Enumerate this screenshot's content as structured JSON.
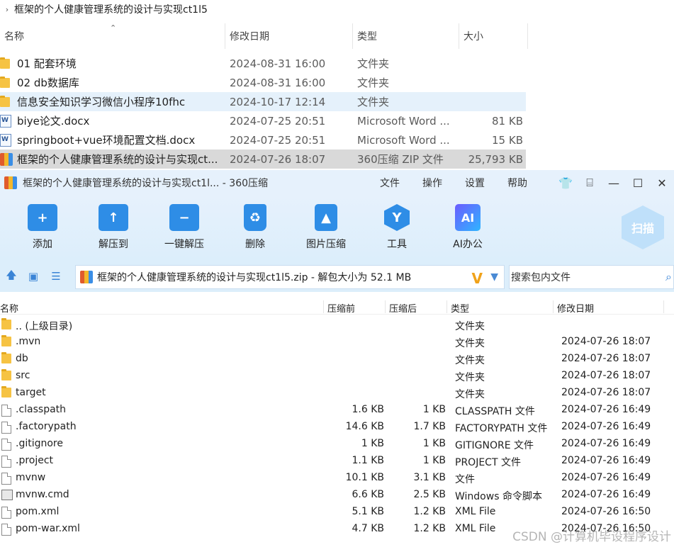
{
  "explorer": {
    "breadcrumb": "框架的个人健康管理系统的设计与实现ct1l5",
    "columns": {
      "name": "名称",
      "modified": "修改日期",
      "type": "类型",
      "size": "大小"
    },
    "rows": [
      {
        "name": "01 配套环境",
        "date": "2024-08-31 16:00",
        "type": "文件夹",
        "size": "",
        "icon": "folder-icon"
      },
      {
        "name": "02 db数据库",
        "date": "2024-08-31 16:00",
        "type": "文件夹",
        "size": "",
        "icon": "folder-icon"
      },
      {
        "name": "信息安全知识学习微信小程序10fhc",
        "date": "2024-10-17 12:14",
        "type": "文件夹",
        "size": "",
        "icon": "folder-icon"
      },
      {
        "name": "biye论文.docx",
        "date": "2024-07-25 20:51",
        "type": "Microsoft Word ...",
        "size": "81 KB",
        "icon": "word-doc-icon"
      },
      {
        "name": "springboot+vue环境配置文档.docx",
        "date": "2024-07-25 20:51",
        "type": "Microsoft Word ...",
        "size": "15 KB",
        "icon": "word-doc-icon"
      },
      {
        "name": "框架的个人健康管理系统的设计与实现ct...",
        "date": "2024-07-26 18:07",
        "type": "360压缩 ZIP 文件",
        "size": "25,793 KB",
        "icon": "zip-icon"
      }
    ]
  },
  "window": {
    "title": "框架的个人健康管理系统的设计与实现ct1l... - 360压缩",
    "menu": [
      "文件",
      "操作",
      "设置",
      "帮助"
    ],
    "toolbar": [
      {
        "label": "添加",
        "icon": "add-icon"
      },
      {
        "label": "解压到",
        "icon": "extract-to-icon"
      },
      {
        "label": "一键解压",
        "icon": "one-click-extract-icon"
      },
      {
        "label": "删除",
        "icon": "delete-icon"
      },
      {
        "label": "图片压缩",
        "icon": "image-compress-icon"
      },
      {
        "label": "工具",
        "icon": "tools-icon"
      },
      {
        "label": "AI办公",
        "icon": "ai-office-icon"
      }
    ],
    "scan_label": "扫描",
    "ai_icon_text": "AI",
    "address": "框架的个人健康管理系统的设计与实现ct1l5.zip - 解包大小为 52.1 MB",
    "search_placeholder": "搜索包内文件",
    "list_columns": {
      "name": "名称",
      "compressed": "压缩前",
      "after": "压缩后",
      "type": "类型",
      "date": "修改日期"
    },
    "files": [
      {
        "name": ".. (上级目录)",
        "comp": "",
        "after": "",
        "type": "文件夹",
        "date": "",
        "icon": "folder"
      },
      {
        "name": ".mvn",
        "comp": "",
        "after": "",
        "type": "文件夹",
        "date": "2024-07-26 18:07",
        "icon": "folder"
      },
      {
        "name": "db",
        "comp": "",
        "after": "",
        "type": "文件夹",
        "date": "2024-07-26 18:07",
        "icon": "folder"
      },
      {
        "name": "src",
        "comp": "",
        "after": "",
        "type": "文件夹",
        "date": "2024-07-26 18:07",
        "icon": "folder"
      },
      {
        "name": "target",
        "comp": "",
        "after": "",
        "type": "文件夹",
        "date": "2024-07-26 18:07",
        "icon": "folder"
      },
      {
        "name": ".classpath",
        "comp": "1.6 KB",
        "after": "1 KB",
        "type": "CLASSPATH 文件",
        "date": "2024-07-26 16:49",
        "icon": "file"
      },
      {
        "name": ".factorypath",
        "comp": "14.6 KB",
        "after": "1.7 KB",
        "type": "FACTORYPATH 文件",
        "date": "2024-07-26 16:49",
        "icon": "file"
      },
      {
        "name": ".gitignore",
        "comp": "1 KB",
        "after": "1 KB",
        "type": "GITIGNORE 文件",
        "date": "2024-07-26 16:49",
        "icon": "file"
      },
      {
        "name": ".project",
        "comp": "1.1 KB",
        "after": "1 KB",
        "type": "PROJECT 文件",
        "date": "2024-07-26 16:49",
        "icon": "file"
      },
      {
        "name": "mvnw",
        "comp": "10.1 KB",
        "after": "3.1 KB",
        "type": "文件",
        "date": "2024-07-26 16:49",
        "icon": "file"
      },
      {
        "name": "mvnw.cmd",
        "comp": "6.6 KB",
        "after": "2.5 KB",
        "type": "Windows 命令脚本",
        "date": "2024-07-26 16:49",
        "icon": "cmd"
      },
      {
        "name": "pom.xml",
        "comp": "5.1 KB",
        "after": "1.2 KB",
        "type": "XML File",
        "date": "2024-07-26 16:50",
        "icon": "file"
      },
      {
        "name": "pom-war.xml",
        "comp": "4.7 KB",
        "after": "1.2 KB",
        "type": "XML File",
        "date": "2024-07-26 16:50",
        "icon": "file"
      }
    ]
  },
  "watermark": "CSDN @计算机毕设程序设计"
}
